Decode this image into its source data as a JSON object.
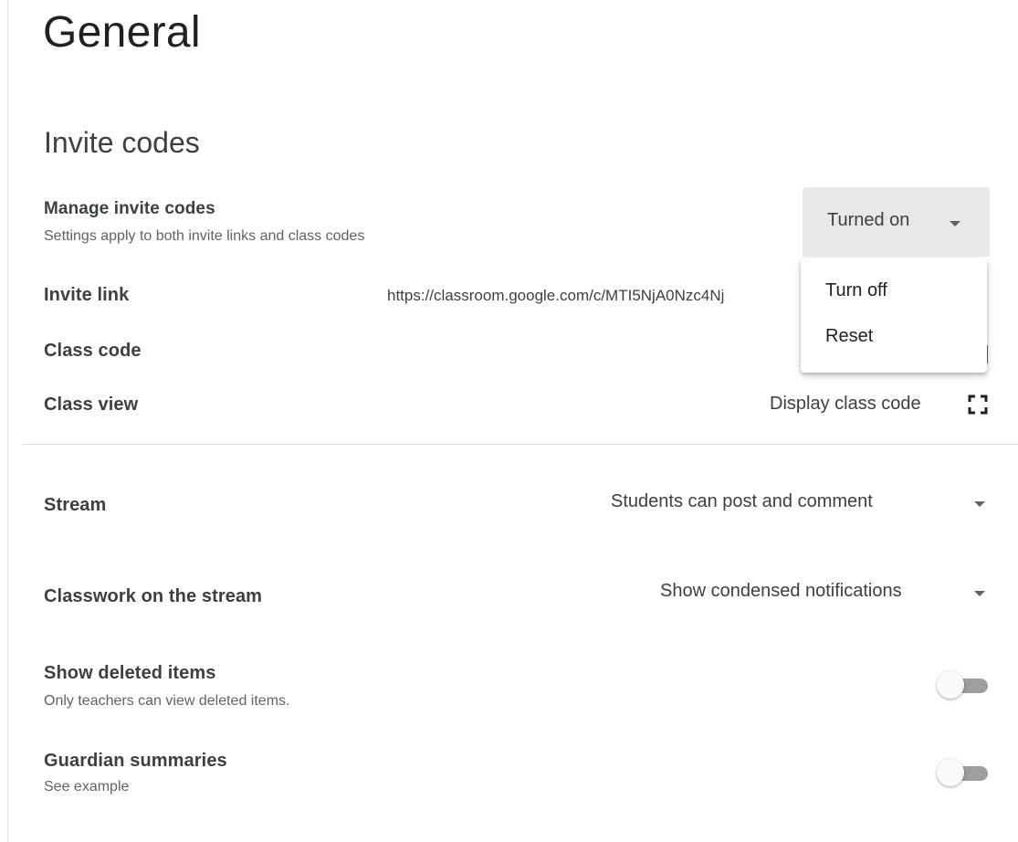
{
  "page": {
    "title": "General"
  },
  "invite_codes": {
    "section_title": "Invite codes",
    "manage": {
      "label": "Manage invite codes",
      "description": "Settings apply to both invite links and class codes",
      "selected": "Turned on",
      "menu_items": [
        "Turn off",
        "Reset"
      ]
    },
    "invite_link": {
      "label": "Invite link",
      "value": "https://classroom.google.com/c/MTI5NjA0Nzc4Nj"
    },
    "class_code": {
      "label": "Class code"
    },
    "class_view": {
      "label": "Class view",
      "action": "Display class code"
    }
  },
  "stream": {
    "label": "Stream",
    "selected": "Students can post and comment"
  },
  "classwork_stream": {
    "label": "Classwork on the stream",
    "selected": "Show condensed notifications"
  },
  "deleted_items": {
    "label": "Show deleted items",
    "description": "Only teachers can view deleted items.",
    "enabled": false
  },
  "guardian_summaries": {
    "label": "Guardian summaries",
    "description": "See example",
    "enabled": false
  },
  "icons": {
    "caret": "chevron-down-icon",
    "fullscreen": "fullscreen-icon"
  },
  "colors": {
    "dropdown_bg": "#e8e8e8",
    "toggle_track": "#9e9e9e",
    "text": "#3c4043"
  }
}
